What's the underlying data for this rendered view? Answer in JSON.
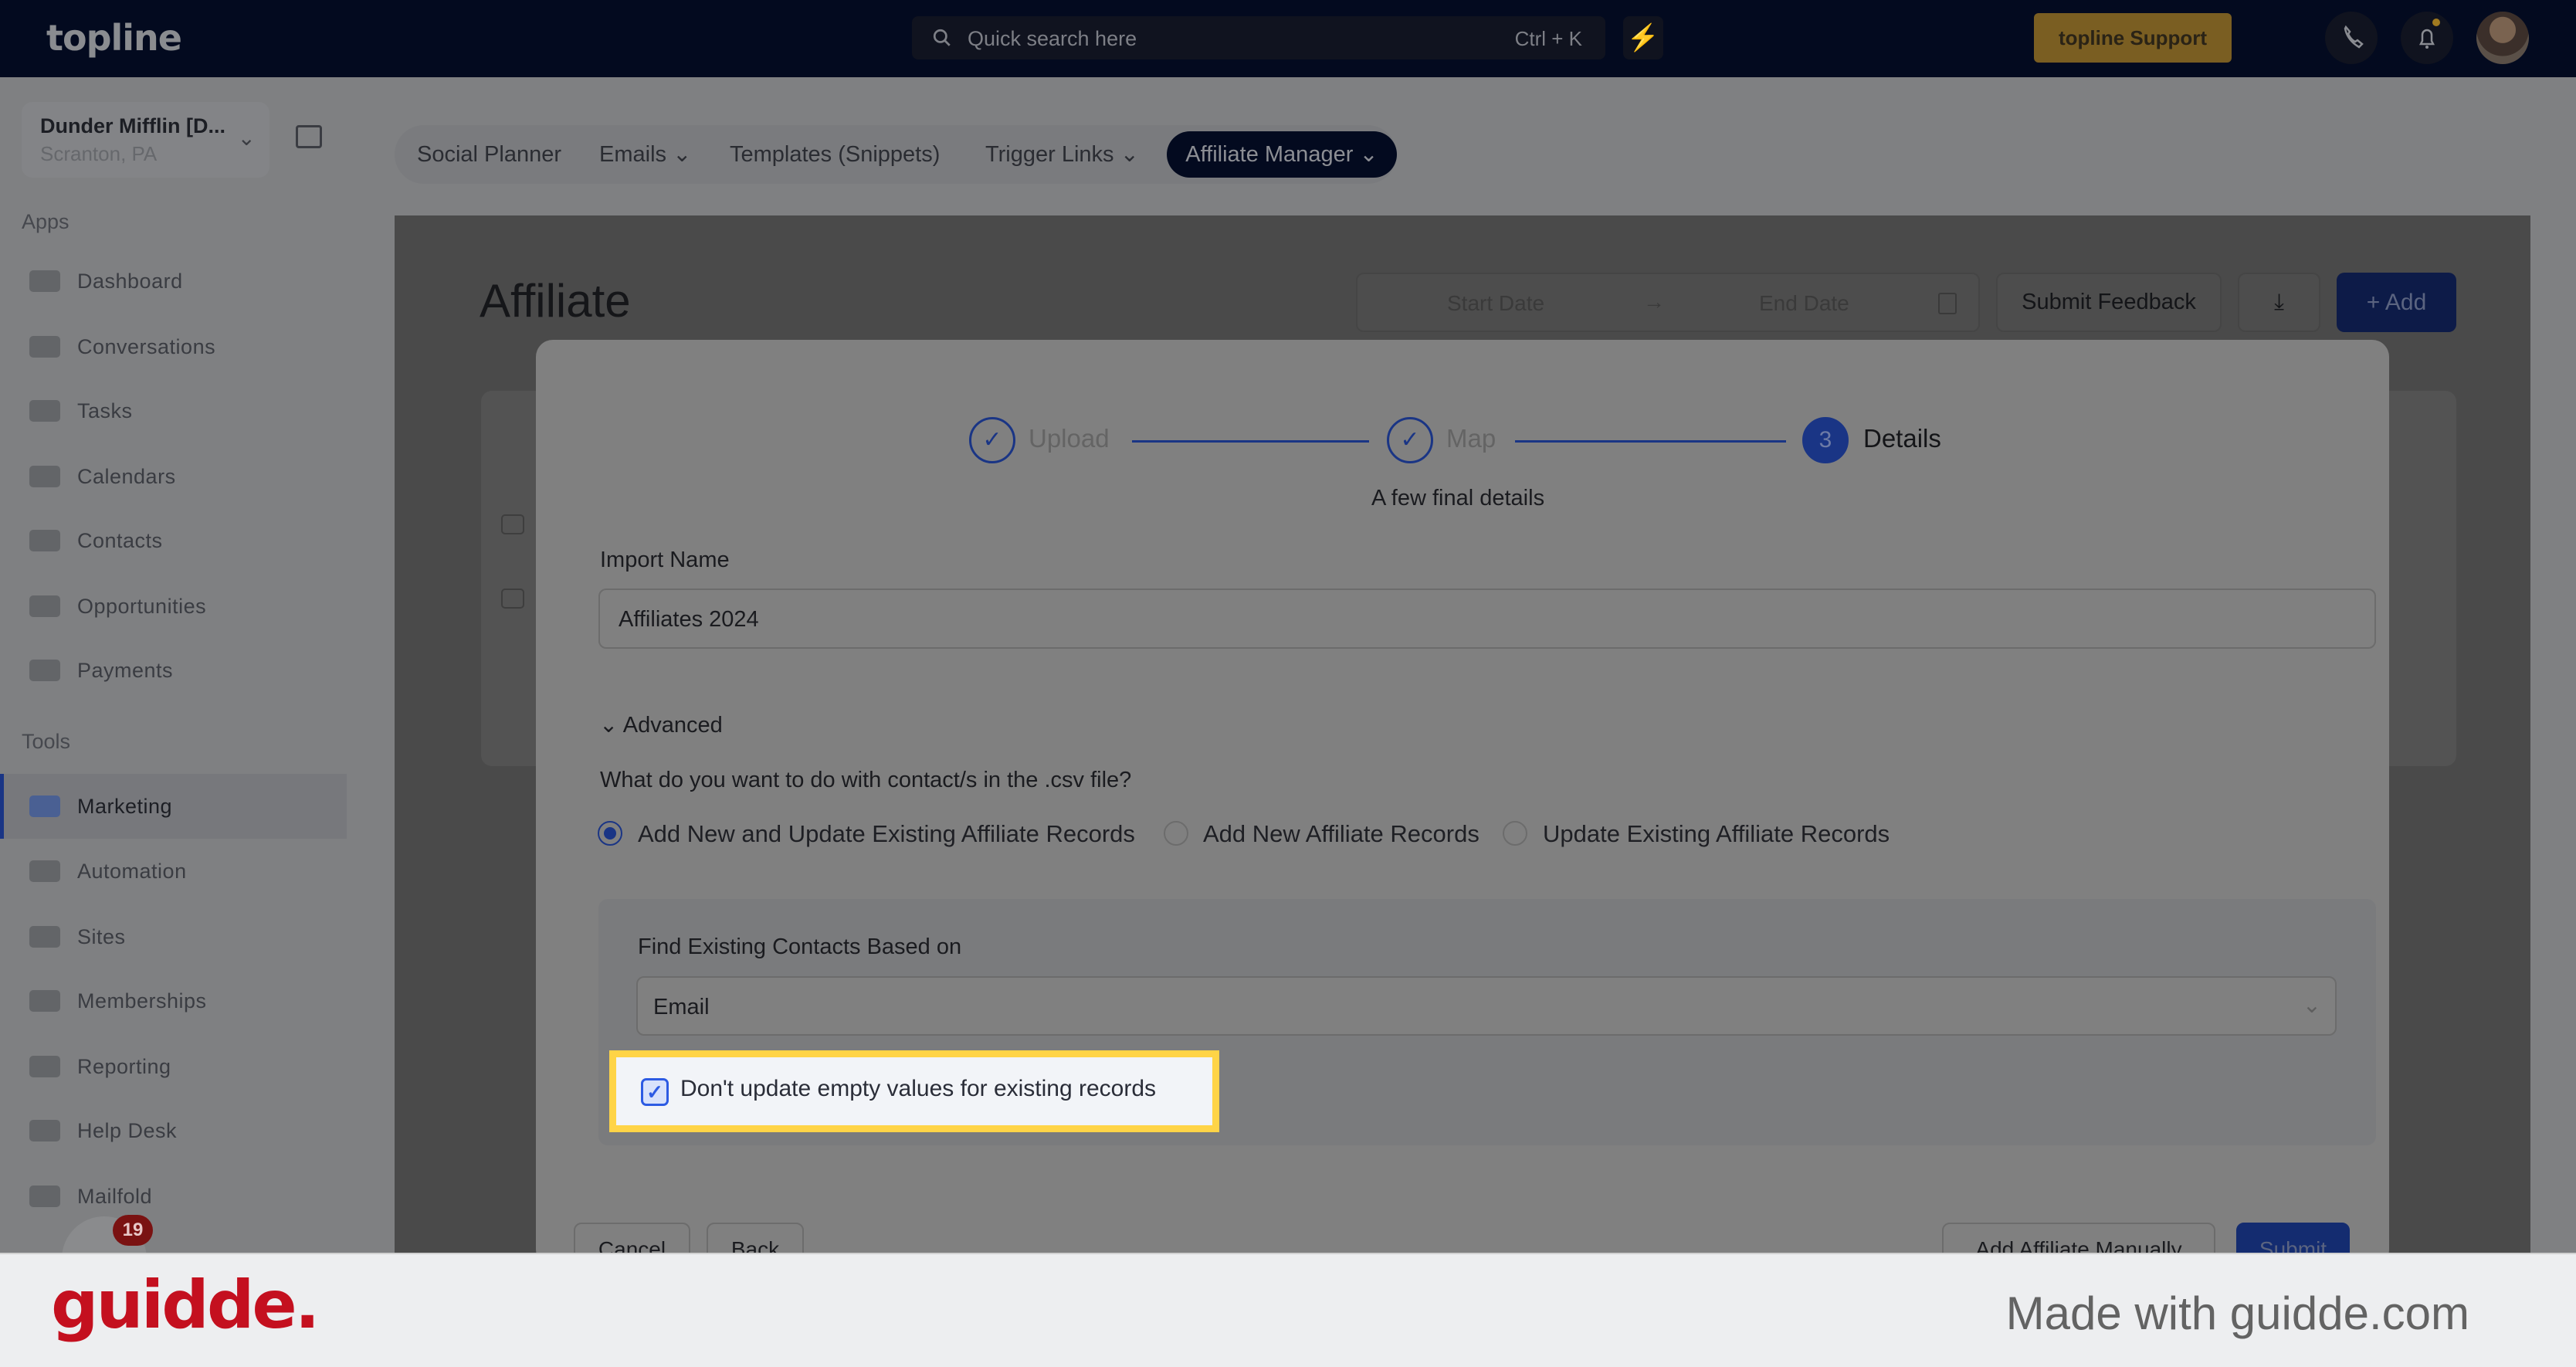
{
  "header": {
    "logo": "topline",
    "search_placeholder": "Quick search here",
    "search_shortcut": "Ctrl + K",
    "support_label": "topline Support"
  },
  "sidebar": {
    "location_name": "Dunder Mifflin [D...",
    "location_sub": "Scranton, PA",
    "apps_label": "Apps",
    "tools_label": "Tools",
    "apps": [
      {
        "label": "Dashboard",
        "icon": "dashboard-icon"
      },
      {
        "label": "Conversations",
        "icon": "chat-icon"
      },
      {
        "label": "Tasks",
        "icon": "tasks-icon"
      },
      {
        "label": "Calendars",
        "icon": "calendar-icon"
      },
      {
        "label": "Contacts",
        "icon": "person-icon"
      },
      {
        "label": "Opportunities",
        "icon": "target-icon"
      },
      {
        "label": "Payments",
        "icon": "credit-card-icon"
      }
    ],
    "tools": [
      {
        "label": "Marketing",
        "icon": "megaphone-icon",
        "active": true
      },
      {
        "label": "Automation",
        "icon": "gears-icon"
      },
      {
        "label": "Sites",
        "icon": "globe-icon"
      },
      {
        "label": "Memberships",
        "icon": "users-icon"
      },
      {
        "label": "Reporting",
        "icon": "pie-chart-icon"
      },
      {
        "label": "Help Desk",
        "icon": "help-icon"
      },
      {
        "label": "Mailfold",
        "icon": "mail-icon"
      }
    ],
    "notification_badge": "19"
  },
  "subnav": {
    "items": [
      "Social Planner",
      "Emails",
      "Templates (Snippets)",
      "Trigger Links"
    ],
    "active": "Affiliate Manager"
  },
  "page": {
    "title": "Affiliate",
    "start_date": "Start Date",
    "end_date": "End Date",
    "submit_feedback": "Submit Feedback",
    "add": "+ Add"
  },
  "modal": {
    "steps": [
      {
        "label": "Upload",
        "state": "done"
      },
      {
        "label": "Map",
        "state": "done"
      },
      {
        "label": "Details",
        "number": "3",
        "state": "current"
      }
    ],
    "subtitle": "A few final details",
    "import_name_label": "Import Name",
    "import_name_value": "Affiliates 2024",
    "advanced_label": "Advanced",
    "question": "What do you want to do with contact/s in the .csv file?",
    "options": [
      {
        "label": "Add New and Update Existing Affiliate Records",
        "selected": true
      },
      {
        "label": "Add New Affiliate Records",
        "selected": false
      },
      {
        "label": "Update Existing Affiliate Records",
        "selected": false
      }
    ],
    "find_label": "Find Existing Contacts Based on",
    "find_value": "Email",
    "checkbox_label": "Don't update empty values for existing records",
    "checkbox_checked": true,
    "buttons": {
      "cancel": "Cancel",
      "back": "Back",
      "add_manually": "Add Affiliate Manually",
      "submit": "Submit"
    }
  },
  "footer": {
    "logo": "guidde.",
    "made_with": "Made with guidde.com"
  },
  "colors": {
    "brand_blue": "#1a3585",
    "highlight": "#ffd447",
    "guidde_red": "#c4101f",
    "support": "#7a5e22"
  }
}
